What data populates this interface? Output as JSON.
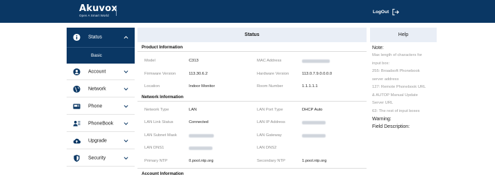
{
  "header": {
    "brand": "Akuvox",
    "tagline": "Open A Smart World",
    "logout_label": "LogOut",
    "logout_icon": "logout-arrow-icon",
    "bar_color": "#0a3764"
  },
  "sidebar": {
    "active_color": "#0a3764",
    "items": [
      {
        "label": "Status",
        "icon": "info-icon",
        "expanded": true,
        "sub": [
          "Basic"
        ]
      },
      {
        "label": "Account",
        "icon": "account-icon"
      },
      {
        "label": "Network",
        "icon": "network-globe-icon"
      },
      {
        "label": "Phone",
        "icon": "phone-icon"
      },
      {
        "label": "PhoneBook",
        "icon": "phonebook-icon"
      },
      {
        "label": "Upgrade",
        "icon": "upgrade-cloud-icon"
      },
      {
        "label": "Security",
        "icon": "security-shield-icon"
      }
    ]
  },
  "main": {
    "title": "Status",
    "product": {
      "title": "Product Information",
      "model_label": "Model",
      "model_value": "C313",
      "mac_label": "MAC Address",
      "fw_label": "Firmware Version",
      "fw_value": "113.30.6.2",
      "hw_label": "Hardware Version",
      "hw_value": "113.0.7.9.0.0.0.0",
      "location_label": "Location",
      "location_value": "Indoor Monitor",
      "room_label": "Room Number",
      "room_value": "1.1.1.1.1"
    },
    "network": {
      "title": "Network Information",
      "type_label": "Network Type",
      "type_value": "LAN",
      "port_label": "LAN Port Type",
      "port_value": "DHCP Auto",
      "link_label": "LAN Link Status",
      "link_value": "Connected",
      "ip_label": "LAN IP Address",
      "mask_label": "LAN Subnet Mask",
      "gw_label": "LAN Gateway",
      "dns1_label": "LAN DNS1",
      "dns2_label": "LAN DNS2",
      "ntp1_label": "Primary NTP",
      "ntp1_value": "0.pool.ntp.org",
      "ntp2_label": "Secondary NTP",
      "ntp2_value": "1.pool.ntp.org"
    },
    "account": {
      "title": "Account Information"
    }
  },
  "help": {
    "title": "Help",
    "note_heading": "Note:",
    "lines": [
      "Max length of characters for",
      "input box:",
      "255: Broadsoft Phonebook",
      "server address",
      "127: Remote Phonebook URL",
      "& AUTOP Manual Update",
      "Server URL",
      "63: The rest of input boxes"
    ],
    "warning_heading": "Warning:",
    "field_heading": "Field Description:"
  }
}
